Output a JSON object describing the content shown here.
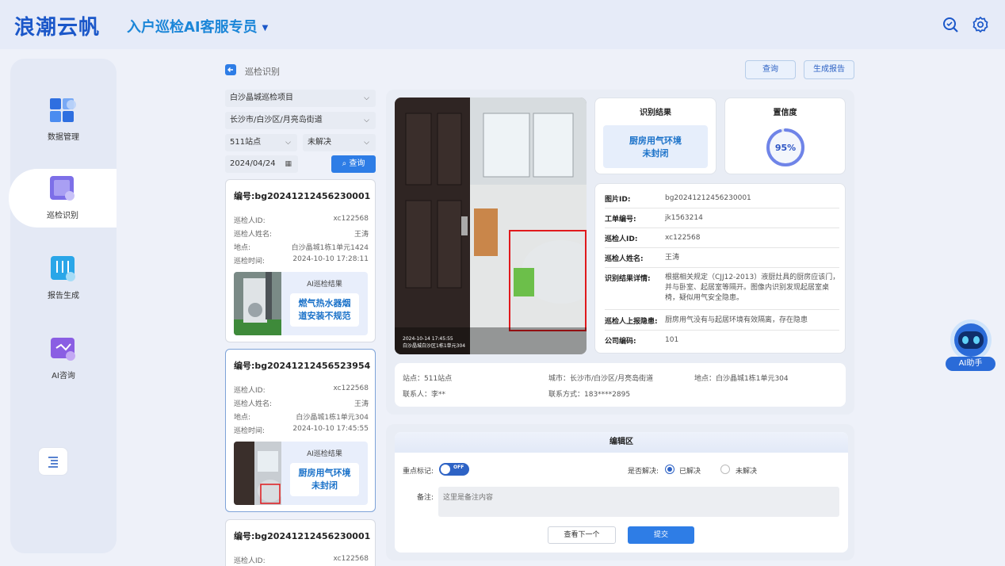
{
  "header": {
    "logo": "浪潮云帆",
    "app_title": "入户巡检AI客服专员"
  },
  "sidebar": {
    "items": [
      {
        "label": "数据管理"
      },
      {
        "label": "巡检识别"
      },
      {
        "label": "报告生成"
      },
      {
        "label": "AI咨询"
      }
    ]
  },
  "topbar": {
    "breadcrumb": "巡检识别",
    "query_label": "查询",
    "report_label": "生成报告"
  },
  "filters": {
    "project": "白沙晶城巡检项目",
    "region": "长沙市/白沙区/月亮岛街道",
    "station": "511站点",
    "status": "未解决",
    "date": "2024/04/24",
    "search_label": "查询"
  },
  "cards": [
    {
      "id": "编号:bg20241212456230001",
      "rows": [
        {
          "k": "巡检人ID:",
          "v": "xc122568"
        },
        {
          "k": "巡检人姓名:",
          "v": "王涛"
        },
        {
          "k": "地点:",
          "v": "白沙晶城1栋1单元1424"
        },
        {
          "k": "巡检时间:",
          "v": "2024-10-10 17:28:11"
        }
      ],
      "res_title": "AI巡检结果",
      "res_line1": "燃气热水器烟",
      "res_line2": "道安装不规范"
    },
    {
      "id": "编号:bg20241212456523954",
      "rows": [
        {
          "k": "巡检人ID:",
          "v": "xc122568"
        },
        {
          "k": "巡检人姓名:",
          "v": "王涛"
        },
        {
          "k": "地点:",
          "v": "白沙晶城1栋1单元304"
        },
        {
          "k": "巡检时间:",
          "v": "2024-10-10 17:45:55"
        }
      ],
      "res_title": "AI巡检结果",
      "res_line1": "厨房用气环境",
      "res_line2": "未封闭"
    },
    {
      "id": "编号:bg20241212456230001",
      "rows": [
        {
          "k": "巡检人ID:",
          "v": "xc122568"
        }
      ]
    }
  ],
  "photo": {
    "timestamp": "2024-10-14 17:45:55",
    "location": "白沙晶城白沙区1栋1单元304"
  },
  "result": {
    "title": "识别结果",
    "line1": "厨房用气环境",
    "line2": "未封闭"
  },
  "confidence": {
    "title": "置信度",
    "value": 95,
    "value_text": "95%"
  },
  "details": [
    {
      "k": "图片ID:",
      "v": "bg20241212456230001"
    },
    {
      "k": "工单编号:",
      "v": "jk1563214"
    },
    {
      "k": "巡检人ID:",
      "v": "xc122568"
    },
    {
      "k": "巡检人姓名:",
      "v": "王涛"
    },
    {
      "k": "识别结果详情:",
      "v": "根据相关规定（CJJ12-2013）液厨灶具的厨房应该门，并与卧室、起居室等隔开。图像内识别发现起居室桌椅，疑似用气安全隐患。"
    },
    {
      "k": "巡检人上报隐患:",
      "v": "厨房用气没有与起居环境有效隔离，存在隐患"
    },
    {
      "k": "公司编码:",
      "v": "101"
    }
  ],
  "info": {
    "station": "站点：511站点",
    "city": "城市：长沙市/白沙区/月亮岛街道",
    "address": "地点：白沙晶城1栋1单元304",
    "contact": "联系人：李**",
    "phone": "联系方式：183****2895"
  },
  "edit": {
    "title": "编辑区",
    "mark_label": "重点标记:",
    "toggle_text": "OFF",
    "resolved_label": "是否解决:",
    "opt_resolved": "已解决",
    "opt_unresolved": "未解决",
    "note_label": "备注:",
    "note_placeholder": "这里是备注内容",
    "next_label": "查看下一个",
    "submit_label": "提交"
  },
  "ai": {
    "label": "AI助手"
  },
  "colors": {
    "primary": "#2e7de6",
    "brand": "#1b57c9",
    "highlight_red": "#e0191c"
  }
}
